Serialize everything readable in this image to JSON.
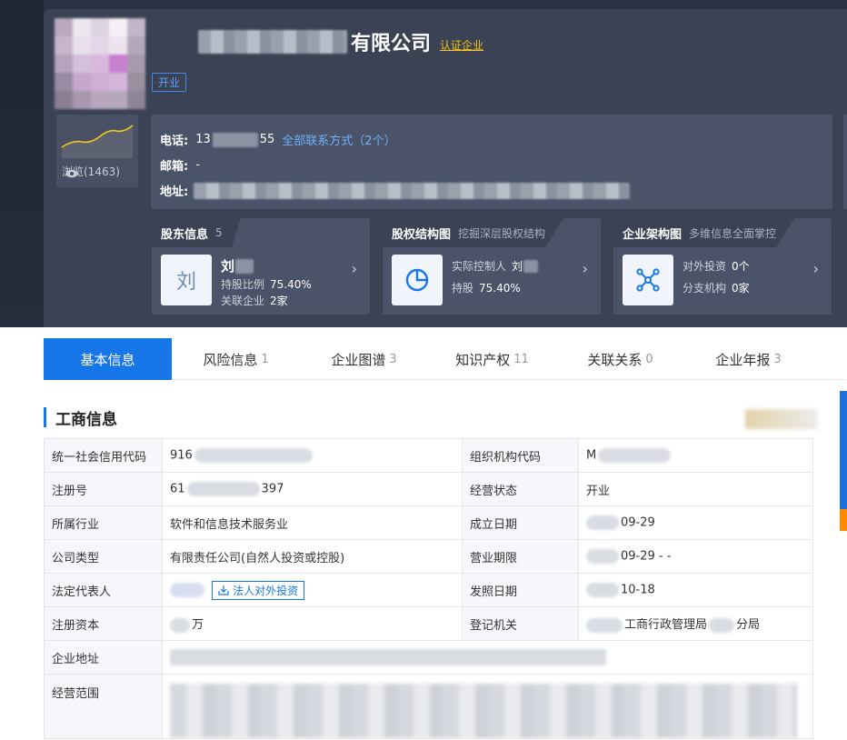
{
  "header": {
    "company_suffix": "有限公司",
    "cert_link": "认证企业",
    "status_tag": "开业",
    "views_label": "浏览(1463)"
  },
  "contact": {
    "phone_label": "电话:",
    "phone_prefix": "13",
    "phone_suffix": "55",
    "all_contacts_link": "全部联系方式（2个）",
    "email_label": "邮箱:",
    "email_value": "-",
    "address_label": "地址:"
  },
  "cards": [
    {
      "title": "股东信息",
      "subtitle": "5",
      "icon_text": "刘",
      "name": "刘",
      "rows": [
        {
          "label": "持股比例",
          "value": "75.40%"
        },
        {
          "label": "关联企业",
          "value": "2家"
        }
      ]
    },
    {
      "title": "股权结构图",
      "subtitle": "挖掘深层股权结构",
      "rows": [
        {
          "label": "实际控制人",
          "value": "刘"
        },
        {
          "label": "持股",
          "value": "75.40%"
        }
      ]
    },
    {
      "title": "企业架构图",
      "subtitle": "多维信息全面掌控",
      "rows": [
        {
          "label": "对外投资",
          "value": "0个"
        },
        {
          "label": "分支机构",
          "value": "0家"
        }
      ]
    }
  ],
  "tabs": [
    {
      "label": "基本信息",
      "count": ""
    },
    {
      "label": "风险信息",
      "count": "1"
    },
    {
      "label": "企业图谱",
      "count": "3"
    },
    {
      "label": "知识产权",
      "count": "11"
    },
    {
      "label": "关联关系",
      "count": "0"
    },
    {
      "label": "企业年报",
      "count": "3"
    }
  ],
  "section": {
    "title": "工商信息"
  },
  "info": {
    "credit_code_label": "统一社会信用代码",
    "credit_code_value": "916",
    "org_code_label": "组织机构代码",
    "org_code_value": "M",
    "reg_no_label": "注册号",
    "reg_no_prefix": "61",
    "reg_no_suffix": "397",
    "biz_status_label": "经营状态",
    "biz_status_value": "开业",
    "industry_label": "所属行业",
    "industry_value": "软件和信息技术服务业",
    "founded_label": "成立日期",
    "founded_value": "09-29",
    "company_type_label": "公司类型",
    "company_type_value": "有限责任公司(自然人投资或控股)",
    "term_label": "营业期限",
    "term_value": "09-29 - -",
    "legal_rep_label": "法定代表人",
    "legal_rep_button": "法人对外投资",
    "issue_date_label": "发照日期",
    "issue_date_value": "10-18",
    "capital_label": "注册资本",
    "capital_value": "万",
    "authority_label": "登记机关",
    "authority_mid": "工商行政管理局",
    "authority_suffix": "分局",
    "address_label": "企业地址",
    "scope_label": "经营范围"
  },
  "colors": {
    "accent": "#1877e8",
    "dark_bg": "#3a4254",
    "card_bg": "#4a5368",
    "cert_gold": "#f5c518"
  }
}
